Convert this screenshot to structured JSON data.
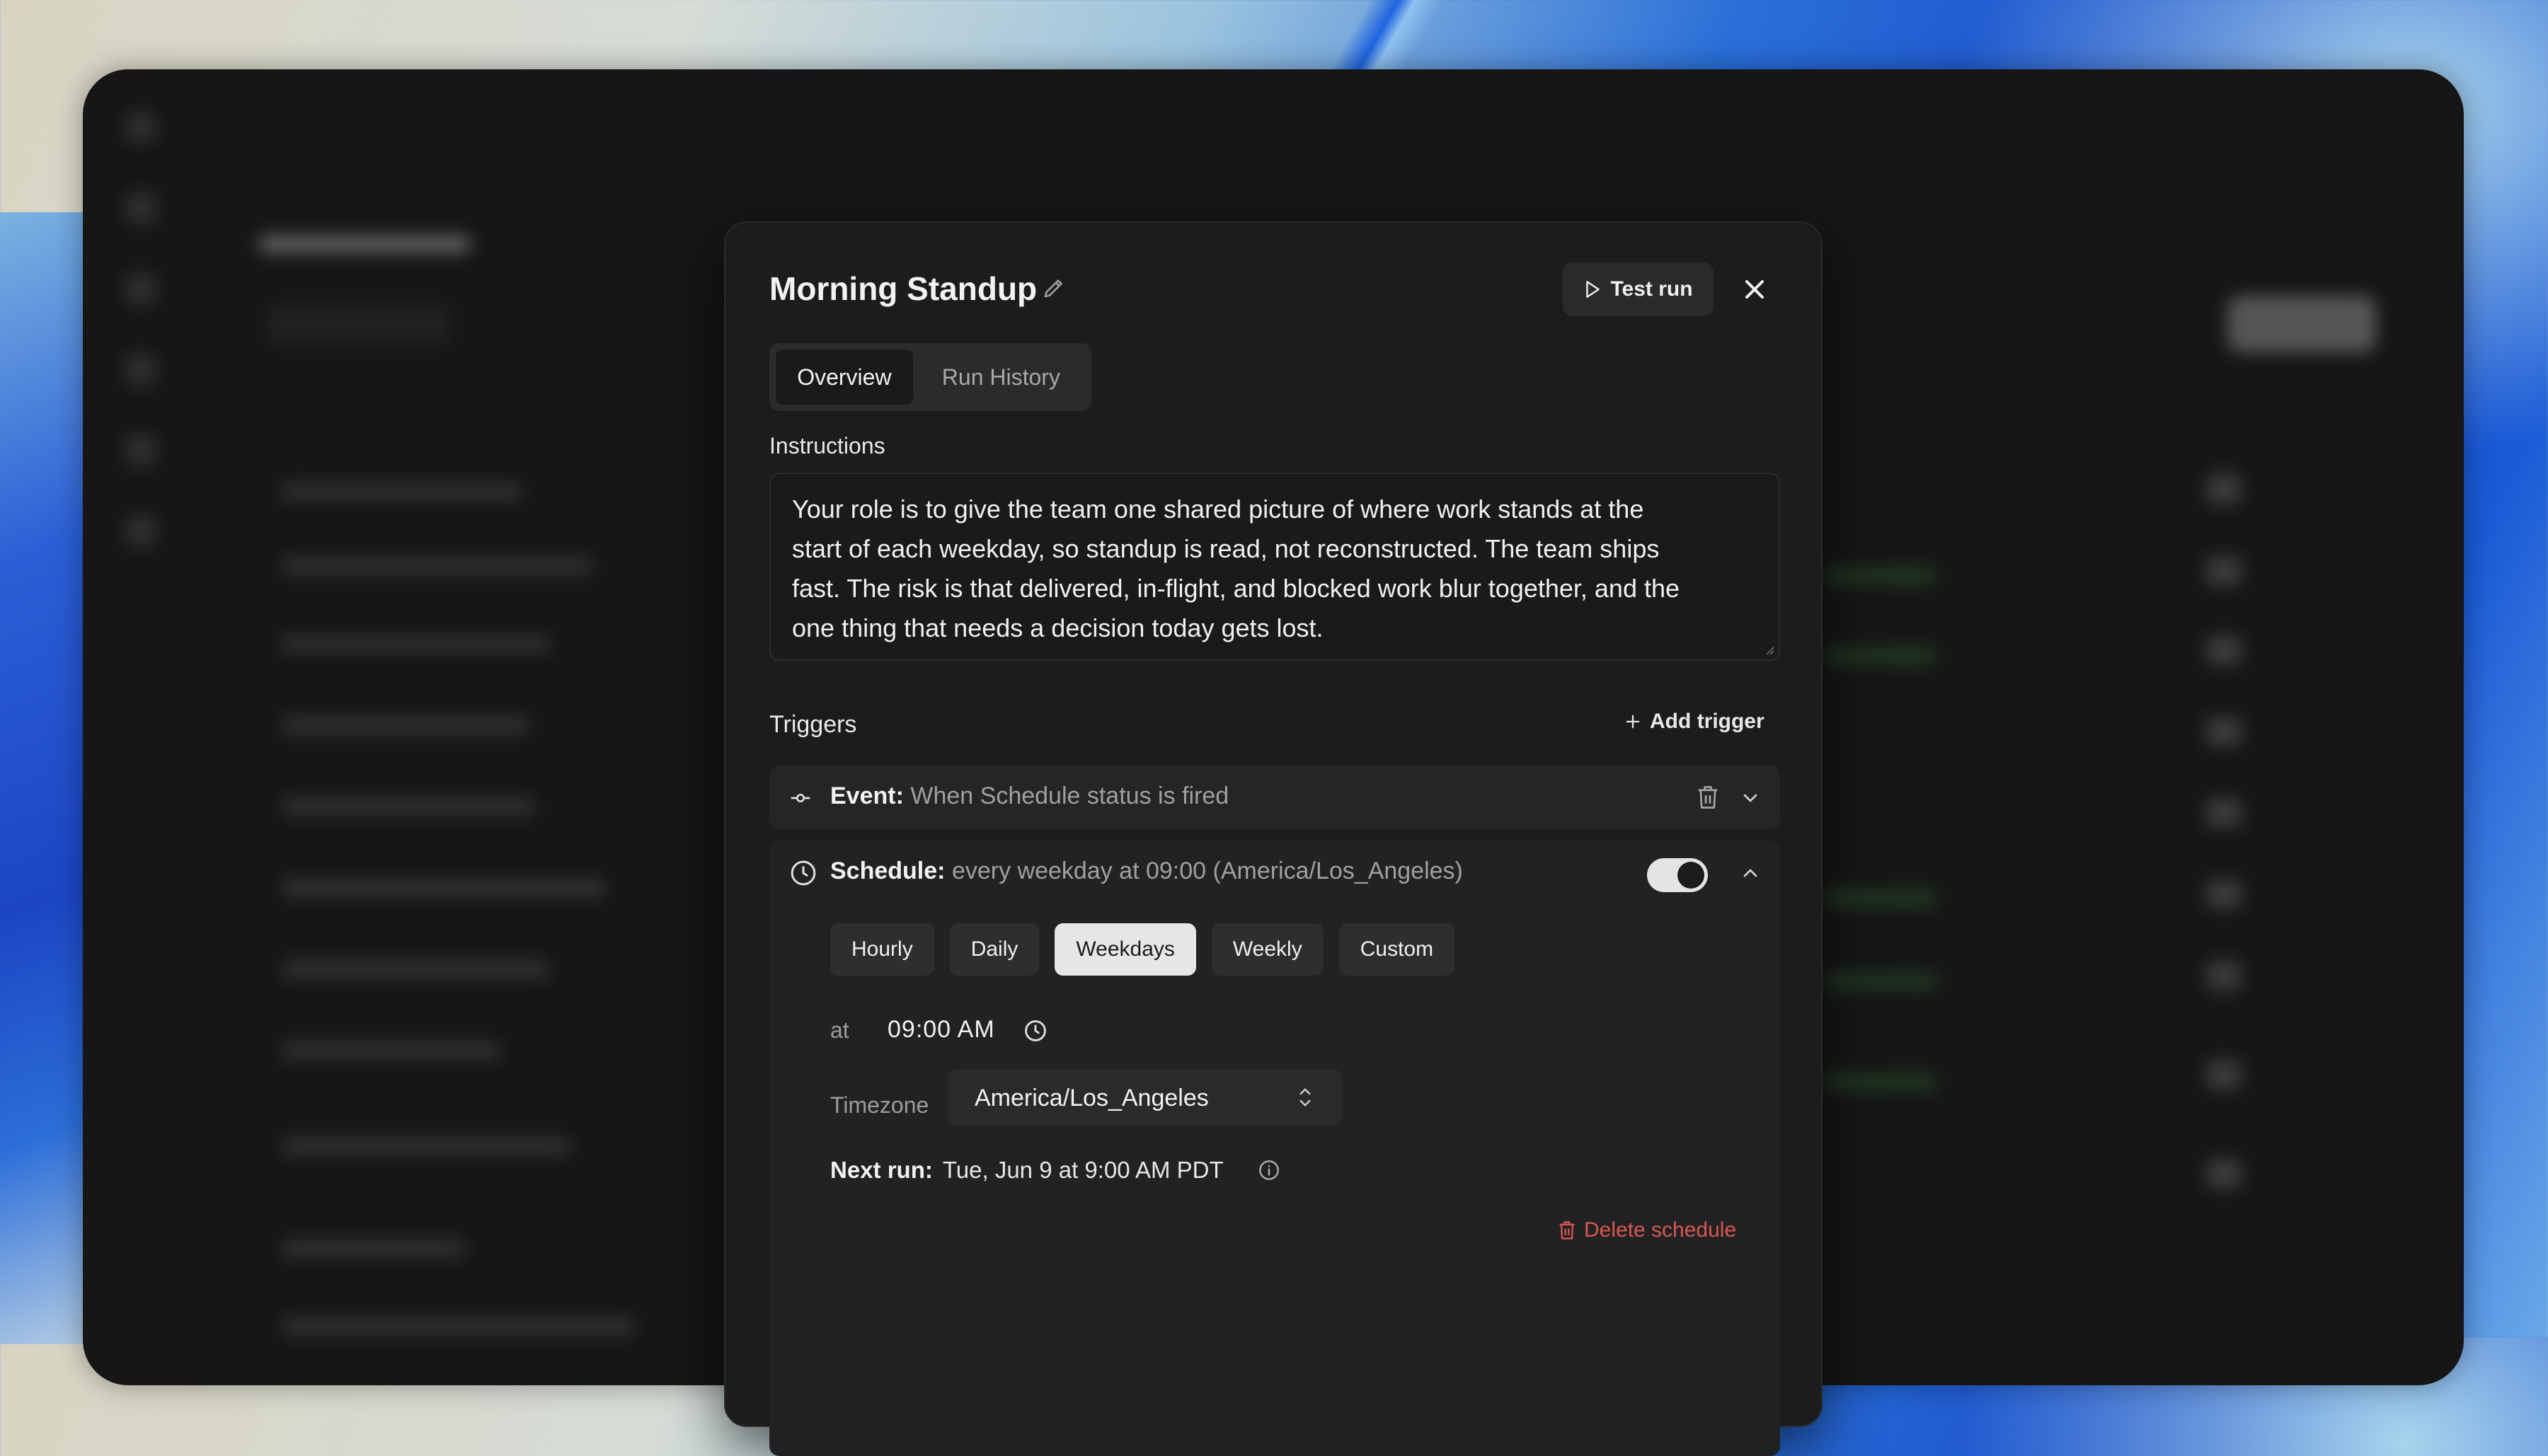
{
  "modal": {
    "title": "Morning Standup",
    "test_run_label": "Test run",
    "tabs": [
      {
        "label": "Overview",
        "active": true
      },
      {
        "label": "Run History",
        "active": false
      }
    ],
    "instructions_label": "Instructions",
    "instructions_text": "Your role is to give the team one shared picture of where work stands at the start of each weekday, so standup is read, not reconstructed. The team ships fast. The risk is that delivered, in-flight, and blocked work blur together, and the one thing that needs a decision today gets lost.",
    "triggers_label": "Triggers",
    "add_trigger_label": "Add trigger",
    "event_trigger": {
      "label": "Event:",
      "description": "When Schedule status is fired"
    },
    "schedule_trigger": {
      "label": "Schedule:",
      "description": "every weekday at 09:00 (America/Los_Angeles)",
      "enabled": true,
      "frequency_options": [
        "Hourly",
        "Daily",
        "Weekdays",
        "Weekly",
        "Custom"
      ],
      "selected_frequency": "Weekdays",
      "at_label": "at",
      "time": "09:00 AM",
      "timezone_label": "Timezone",
      "timezone": "America/Los_Angeles",
      "next_run_label": "Next run:",
      "next_run_value": "Tue, Jun 9 at 9:00 AM PDT",
      "delete_label": "Delete schedule"
    }
  },
  "colors": {
    "accent_danger": "#d9584f",
    "selected_chip": "#e6e6e6",
    "modal_bg": "#1c1c1d"
  }
}
